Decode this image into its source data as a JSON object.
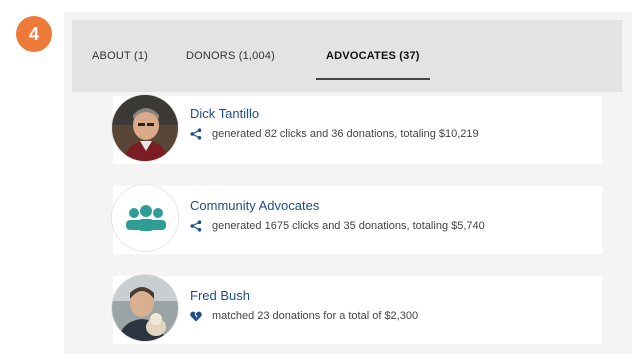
{
  "step": {
    "number": "4"
  },
  "tabs": [
    {
      "label": "ABOUT (1)"
    },
    {
      "label": "DONORS (1,004)"
    },
    {
      "label": "ADVOCATES (37)"
    }
  ],
  "advocates": [
    {
      "name": "Dick Tantillo",
      "detail": "generated 82 clicks and 36 donations, totaling $10,219",
      "icon": "share-icon",
      "avatar": "photo"
    },
    {
      "name": "Community Advocates",
      "detail": "generated 1675 clicks and 35 donations, totaling $5,740",
      "icon": "share-icon",
      "avatar": "group-icon"
    },
    {
      "name": "Fred Bush",
      "detail": "matched 23 donations for a total of $2,300",
      "icon": "broken-heart-icon",
      "avatar": "photo"
    }
  ],
  "colors": {
    "badge": "#ee7a3a",
    "link": "#1f4e87",
    "group_icon": "#2f9c95",
    "heart": "#1f4e87"
  }
}
